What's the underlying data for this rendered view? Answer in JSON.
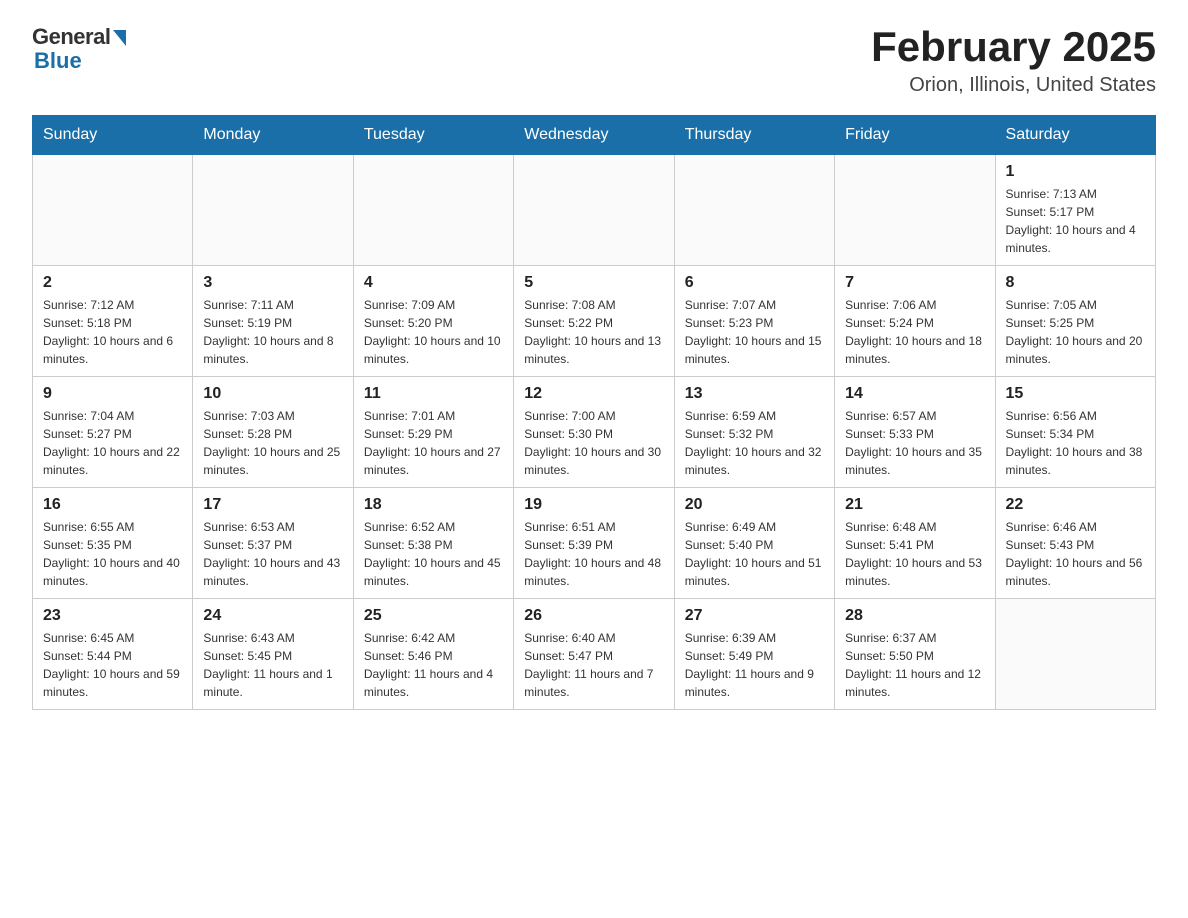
{
  "logo": {
    "general": "General",
    "blue": "Blue"
  },
  "title": "February 2025",
  "subtitle": "Orion, Illinois, United States",
  "weekdays": [
    "Sunday",
    "Monday",
    "Tuesday",
    "Wednesday",
    "Thursday",
    "Friday",
    "Saturday"
  ],
  "weeks": [
    [
      null,
      null,
      null,
      null,
      null,
      null,
      {
        "day": "1",
        "sunrise": "Sunrise: 7:13 AM",
        "sunset": "Sunset: 5:17 PM",
        "daylight": "Daylight: 10 hours and 4 minutes."
      }
    ],
    [
      {
        "day": "2",
        "sunrise": "Sunrise: 7:12 AM",
        "sunset": "Sunset: 5:18 PM",
        "daylight": "Daylight: 10 hours and 6 minutes."
      },
      {
        "day": "3",
        "sunrise": "Sunrise: 7:11 AM",
        "sunset": "Sunset: 5:19 PM",
        "daylight": "Daylight: 10 hours and 8 minutes."
      },
      {
        "day": "4",
        "sunrise": "Sunrise: 7:09 AM",
        "sunset": "Sunset: 5:20 PM",
        "daylight": "Daylight: 10 hours and 10 minutes."
      },
      {
        "day": "5",
        "sunrise": "Sunrise: 7:08 AM",
        "sunset": "Sunset: 5:22 PM",
        "daylight": "Daylight: 10 hours and 13 minutes."
      },
      {
        "day": "6",
        "sunrise": "Sunrise: 7:07 AM",
        "sunset": "Sunset: 5:23 PM",
        "daylight": "Daylight: 10 hours and 15 minutes."
      },
      {
        "day": "7",
        "sunrise": "Sunrise: 7:06 AM",
        "sunset": "Sunset: 5:24 PM",
        "daylight": "Daylight: 10 hours and 18 minutes."
      },
      {
        "day": "8",
        "sunrise": "Sunrise: 7:05 AM",
        "sunset": "Sunset: 5:25 PM",
        "daylight": "Daylight: 10 hours and 20 minutes."
      }
    ],
    [
      {
        "day": "9",
        "sunrise": "Sunrise: 7:04 AM",
        "sunset": "Sunset: 5:27 PM",
        "daylight": "Daylight: 10 hours and 22 minutes."
      },
      {
        "day": "10",
        "sunrise": "Sunrise: 7:03 AM",
        "sunset": "Sunset: 5:28 PM",
        "daylight": "Daylight: 10 hours and 25 minutes."
      },
      {
        "day": "11",
        "sunrise": "Sunrise: 7:01 AM",
        "sunset": "Sunset: 5:29 PM",
        "daylight": "Daylight: 10 hours and 27 minutes."
      },
      {
        "day": "12",
        "sunrise": "Sunrise: 7:00 AM",
        "sunset": "Sunset: 5:30 PM",
        "daylight": "Daylight: 10 hours and 30 minutes."
      },
      {
        "day": "13",
        "sunrise": "Sunrise: 6:59 AM",
        "sunset": "Sunset: 5:32 PM",
        "daylight": "Daylight: 10 hours and 32 minutes."
      },
      {
        "day": "14",
        "sunrise": "Sunrise: 6:57 AM",
        "sunset": "Sunset: 5:33 PM",
        "daylight": "Daylight: 10 hours and 35 minutes."
      },
      {
        "day": "15",
        "sunrise": "Sunrise: 6:56 AM",
        "sunset": "Sunset: 5:34 PM",
        "daylight": "Daylight: 10 hours and 38 minutes."
      }
    ],
    [
      {
        "day": "16",
        "sunrise": "Sunrise: 6:55 AM",
        "sunset": "Sunset: 5:35 PM",
        "daylight": "Daylight: 10 hours and 40 minutes."
      },
      {
        "day": "17",
        "sunrise": "Sunrise: 6:53 AM",
        "sunset": "Sunset: 5:37 PM",
        "daylight": "Daylight: 10 hours and 43 minutes."
      },
      {
        "day": "18",
        "sunrise": "Sunrise: 6:52 AM",
        "sunset": "Sunset: 5:38 PM",
        "daylight": "Daylight: 10 hours and 45 minutes."
      },
      {
        "day": "19",
        "sunrise": "Sunrise: 6:51 AM",
        "sunset": "Sunset: 5:39 PM",
        "daylight": "Daylight: 10 hours and 48 minutes."
      },
      {
        "day": "20",
        "sunrise": "Sunrise: 6:49 AM",
        "sunset": "Sunset: 5:40 PM",
        "daylight": "Daylight: 10 hours and 51 minutes."
      },
      {
        "day": "21",
        "sunrise": "Sunrise: 6:48 AM",
        "sunset": "Sunset: 5:41 PM",
        "daylight": "Daylight: 10 hours and 53 minutes."
      },
      {
        "day": "22",
        "sunrise": "Sunrise: 6:46 AM",
        "sunset": "Sunset: 5:43 PM",
        "daylight": "Daylight: 10 hours and 56 minutes."
      }
    ],
    [
      {
        "day": "23",
        "sunrise": "Sunrise: 6:45 AM",
        "sunset": "Sunset: 5:44 PM",
        "daylight": "Daylight: 10 hours and 59 minutes."
      },
      {
        "day": "24",
        "sunrise": "Sunrise: 6:43 AM",
        "sunset": "Sunset: 5:45 PM",
        "daylight": "Daylight: 11 hours and 1 minute."
      },
      {
        "day": "25",
        "sunrise": "Sunrise: 6:42 AM",
        "sunset": "Sunset: 5:46 PM",
        "daylight": "Daylight: 11 hours and 4 minutes."
      },
      {
        "day": "26",
        "sunrise": "Sunrise: 6:40 AM",
        "sunset": "Sunset: 5:47 PM",
        "daylight": "Daylight: 11 hours and 7 minutes."
      },
      {
        "day": "27",
        "sunrise": "Sunrise: 6:39 AM",
        "sunset": "Sunset: 5:49 PM",
        "daylight": "Daylight: 11 hours and 9 minutes."
      },
      {
        "day": "28",
        "sunrise": "Sunrise: 6:37 AM",
        "sunset": "Sunset: 5:50 PM",
        "daylight": "Daylight: 11 hours and 12 minutes."
      },
      null
    ]
  ]
}
